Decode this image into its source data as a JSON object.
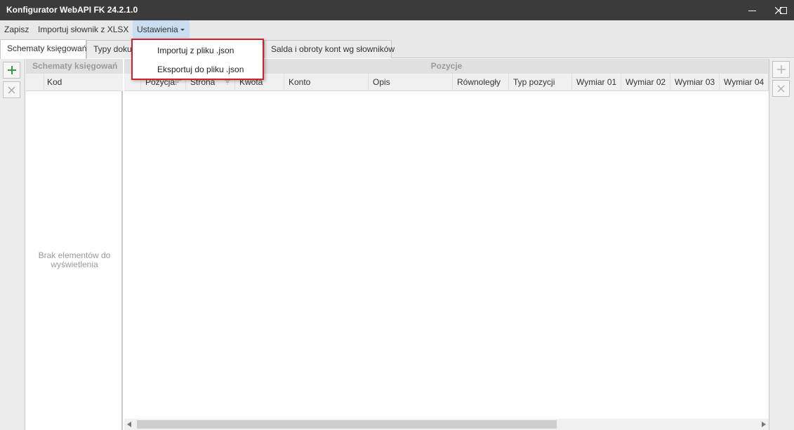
{
  "window": {
    "title": "Konfigurator WebAPI FK 24.2.1.0",
    "controls": [
      "minimize-icon",
      "maximize-icon",
      "close-icon"
    ]
  },
  "menu": {
    "save": "Zapisz",
    "import_xlsx": "Importuj słownik z XLSX",
    "settings": "Ustawienia"
  },
  "settings_dropdown": {
    "import_json": "Importuj z pliku .json",
    "export_json": "Eksportuj do pliku .json"
  },
  "tabs": [
    {
      "label": "Schematy księgowań",
      "selected": true
    },
    {
      "label": "Typy dokumentów",
      "selected": false
    },
    {
      "label": "Salda i obroty kont wg słowników",
      "selected": false
    }
  ],
  "left_panel": {
    "title": "Schematy księgowań",
    "column": "Kod",
    "empty_text_line1": "Brak elementów do",
    "empty_text_line2": "wyświetlenia"
  },
  "right_panel": {
    "title": "Pozycje",
    "columns": [
      "Pozycja",
      "Strona",
      "Kwota",
      "Konto",
      "Opis",
      "Równoległy",
      "Typ pozycji",
      "Wymiar 01",
      "Wymiar 02",
      "Wymiar 03",
      "Wymiar 04"
    ]
  },
  "icons": {
    "add": "plus-icon",
    "delete": "x-icon",
    "sort": "sort-icon",
    "filter": "filter-icon",
    "scroll_left": "arrow-left-icon",
    "scroll_right": "arrow-right-icon"
  },
  "colors": {
    "titlebar": "#3b3b3b",
    "highlight_border": "#d0202a",
    "add_enabled": "#2e9b3e",
    "active_menu": "#c9def0"
  }
}
